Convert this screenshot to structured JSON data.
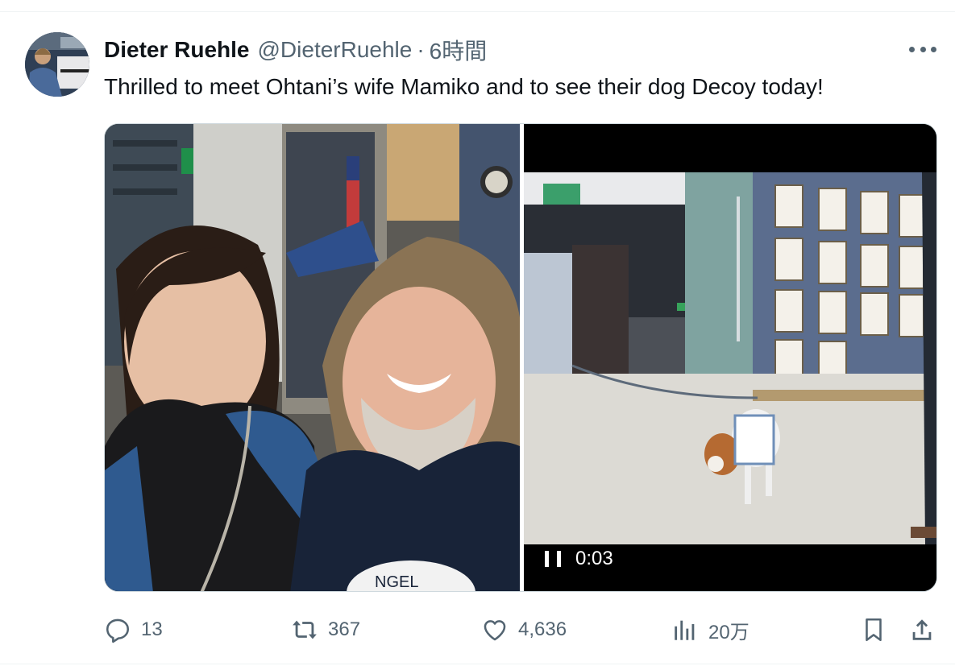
{
  "tweet": {
    "author_name": "Dieter Ruehle",
    "handle": "@DieterRuehle",
    "separator": "·",
    "time": "6時間",
    "text": "Thrilled to meet Ohtani’s wife Mamiko and to see their dog Decoy today!"
  },
  "media": {
    "video_time": "0:03",
    "video_state": "playing",
    "shirt_text": "NGEL"
  },
  "actions": {
    "replies": "13",
    "retweets": "367",
    "likes": "4,636",
    "views": "20万"
  },
  "icons": {
    "more": "more-horizontal-icon",
    "reply": "reply-icon",
    "retweet": "retweet-icon",
    "like": "heart-icon",
    "views": "analytics-icon",
    "bookmark": "bookmark-icon",
    "share": "share-icon",
    "pause": "pause-icon"
  },
  "colors": {
    "text_primary": "#0f1419",
    "text_secondary": "#536471",
    "border": "#cfd9de"
  }
}
